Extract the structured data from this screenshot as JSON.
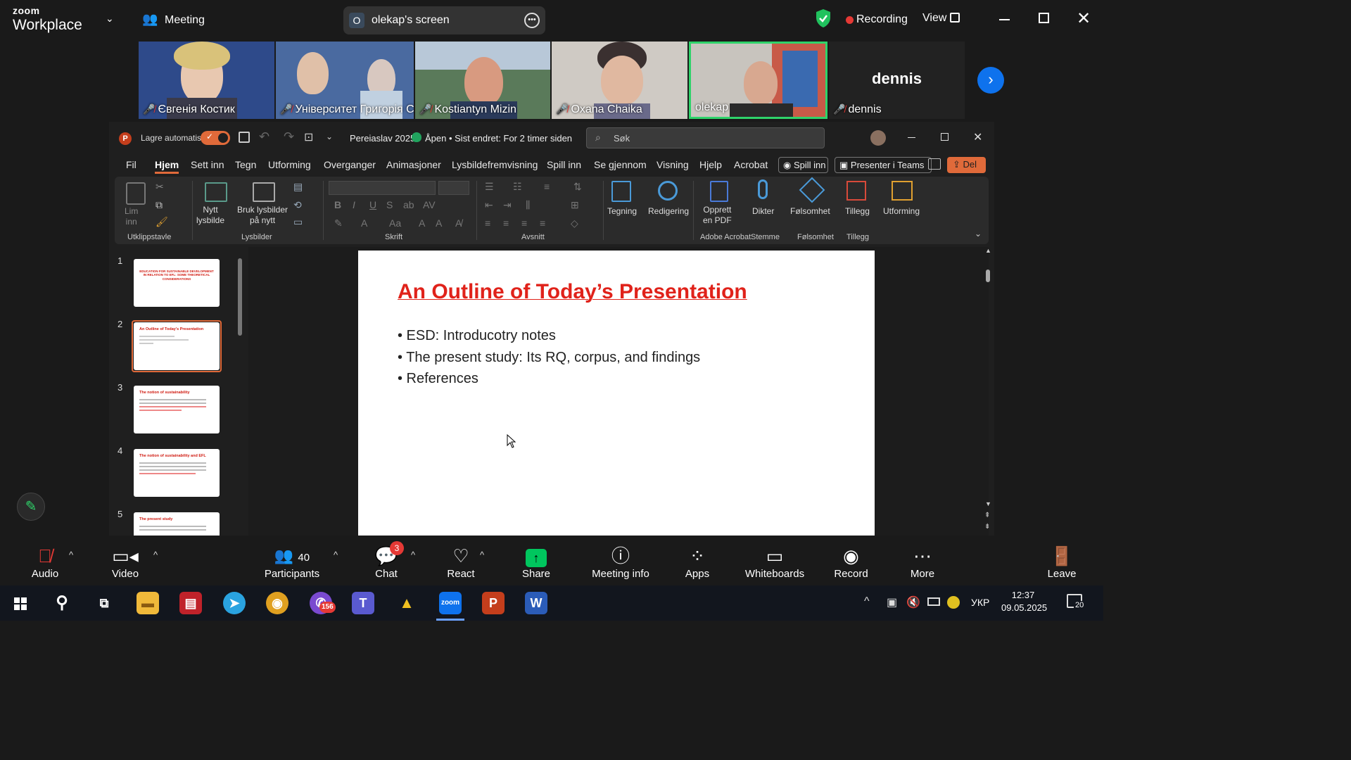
{
  "zoom": {
    "brand_top": "zoom",
    "brand_bottom": "Workplace",
    "meeting_label": "Meeting",
    "share_avatar": "O",
    "share_label": "olekap's screen",
    "recording_label": "Recording",
    "view_label": "View",
    "participants": [
      {
        "name": "Євгенія Костик",
        "muted": true
      },
      {
        "name": "Університет Григорія Ск...",
        "muted": true
      },
      {
        "name": "Kostiantyn Mizin",
        "muted": true
      },
      {
        "name": "Oxana Chaika",
        "muted": true
      },
      {
        "name": "olekap",
        "muted": false
      },
      {
        "name": "dennis",
        "muted": true
      }
    ],
    "dennis_big": "dennis",
    "toolbar": {
      "audio": "Audio",
      "video": "Video",
      "participants": "Participants",
      "participants_count": "40",
      "chat": "Chat",
      "chat_badge": "3",
      "react": "React",
      "share": "Share",
      "meeting_info": "Meeting info",
      "apps": "Apps",
      "whiteboards": "Whiteboards",
      "record": "Record",
      "more": "More",
      "leave": "Leave"
    }
  },
  "ppt": {
    "autosave": "Lagre automatisk",
    "doc_title": "Pereiaslav 2025",
    "doc_status": "Åpen • Sist endret: For 2 timer siden",
    "search_placeholder": "Søk",
    "menu": [
      "Fil",
      "Hjem",
      "Sett inn",
      "Tegn",
      "Utforming",
      "Overganger",
      "Animasjoner",
      "Lysbildefremvisning",
      "Spill inn",
      "Se gjennom",
      "Visning",
      "Hjelp",
      "Acrobat"
    ],
    "spill_inn_btn": "Spill inn",
    "present_teams": "Presenter i Teams",
    "share_btn": "Del",
    "ribbon": {
      "lim_inn": "Lim\ninn",
      "nytt_lysbilde": "Nytt\nlysbilde",
      "bruk_lysbilder": "Bruk lysbilder\npå nytt",
      "tegning": "Tegning",
      "redigering": "Redigering",
      "opprett_pdf": "Opprett\nen PDF",
      "dikter": "Dikter",
      "folsomhet": "Følsomhet",
      "tillegg": "Tillegg",
      "utforming": "Utforming",
      "groups": [
        "Utklippstavle",
        "Lysbilder",
        "Skrift",
        "Avsnitt",
        "Adobe Acrobat",
        "Stemme",
        "Følsomhet",
        "Tillegg"
      ]
    },
    "thumbnails": [
      {
        "num": "1",
        "title": "EDUCATION FOR SUSTAINABLE DEVELOPMENT IN RELATION TO EFL: SOME THEORETICAL CONSIDERATIONS"
      },
      {
        "num": "2",
        "title": "An Outline of Today's Presentation"
      },
      {
        "num": "3",
        "title": "The notion of sustainability"
      },
      {
        "num": "4",
        "title": "The notion of sustainability and EFL"
      },
      {
        "num": "5",
        "title": "The present study"
      }
    ],
    "slide": {
      "title": "An Outline of Today’s Presentation",
      "bullets": [
        "• ESD: Introducotry notes",
        "• The present study: Its RQ, corpus, and findings",
        "• References"
      ]
    }
  },
  "taskbar": {
    "lang": "УКР",
    "time": "12:37",
    "date": "09.05.2025",
    "notif_count": "20",
    "viber_badge": "156"
  },
  "colors": {
    "accent_red": "#e0221a",
    "zoom_blue": "#0e72ed",
    "recording_red": "#e53935",
    "share_green": "#00c65e"
  }
}
